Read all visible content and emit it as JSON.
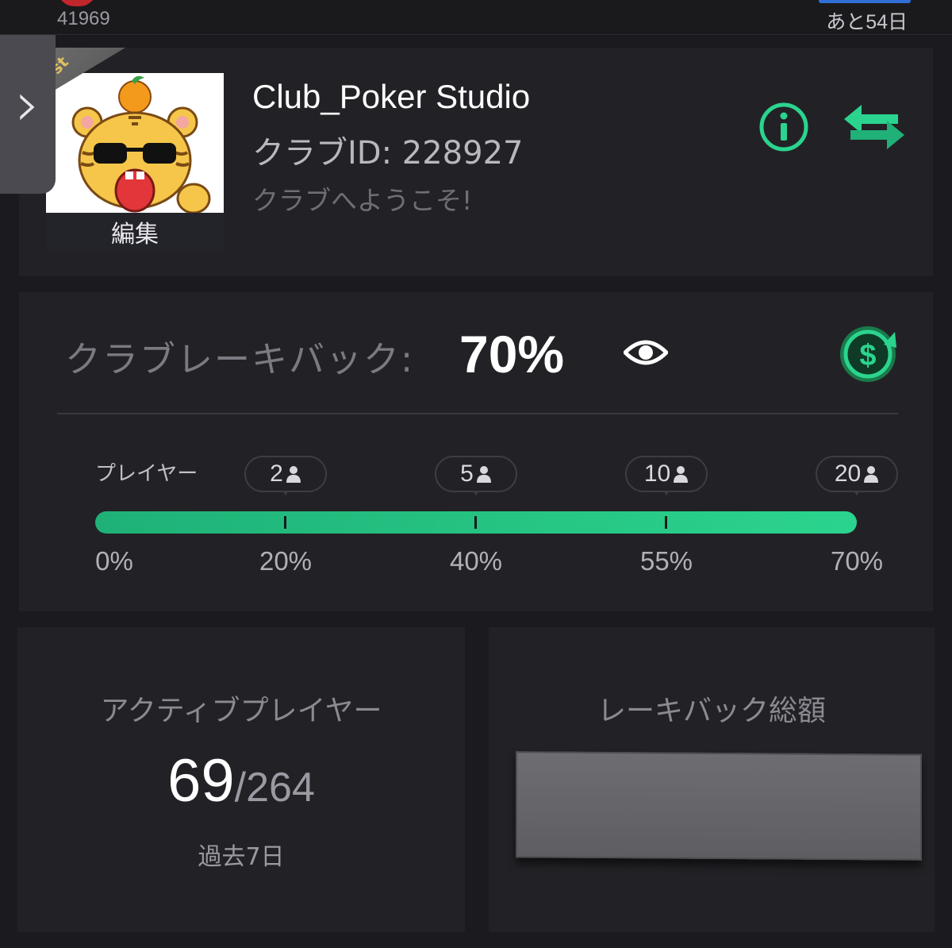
{
  "topbar": {
    "user_id_partial": "41969",
    "days_remaining": "あと54日"
  },
  "side_handle": {
    "glyph": "›"
  },
  "club": {
    "host_tag": "st",
    "edit_label": "編集",
    "name": "Club_Poker Studio",
    "id_text": "クラブID: 228927",
    "welcome": "クラブへようこそ!"
  },
  "rakeback": {
    "label": "クラブレーキバック:",
    "value": "70%",
    "players_label": "プレイヤー",
    "tiers": [
      {
        "players": "2",
        "percent": "20%"
      },
      {
        "players": "5",
        "percent": "40%"
      },
      {
        "players": "10",
        "percent": "55%"
      },
      {
        "players": "20",
        "percent": "70%"
      }
    ],
    "start_percent": "0%",
    "progress_fraction": 1.0
  },
  "active_players": {
    "title": "アクティブプレイヤー",
    "active": "69",
    "total": "/264",
    "period": "過去7日"
  },
  "rakeback_total": {
    "title": "レーキバック総額"
  },
  "colors": {
    "accent_green": "#2bd48e",
    "background": "#1b1b1f",
    "card": "#222226"
  }
}
